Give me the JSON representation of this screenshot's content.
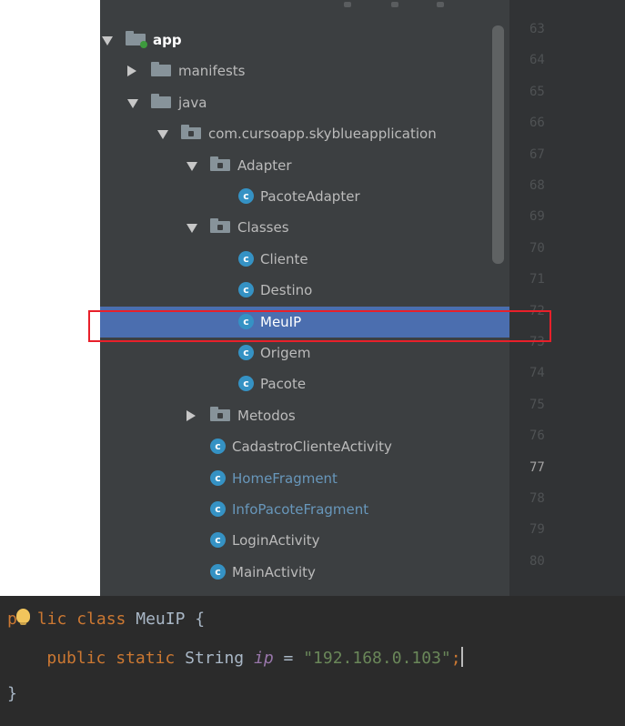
{
  "project_tree": {
    "items": [
      {
        "label": "app",
        "type": "module",
        "arrow": "down",
        "depth": 0
      },
      {
        "label": "manifests",
        "type": "folder",
        "arrow": "right",
        "depth": 1
      },
      {
        "label": "java",
        "type": "folder",
        "arrow": "down",
        "depth": 1
      },
      {
        "label": "com.cursoapp.skyblueapplication",
        "type": "package",
        "arrow": "down",
        "depth": 2
      },
      {
        "label": "Adapter",
        "type": "package",
        "arrow": "down",
        "depth": 3
      },
      {
        "label": "PacoteAdapter",
        "type": "class",
        "arrow": "",
        "depth": 4
      },
      {
        "label": "Classes",
        "type": "package",
        "arrow": "down",
        "depth": 3
      },
      {
        "label": "Cliente",
        "type": "class",
        "arrow": "",
        "depth": 4
      },
      {
        "label": "Destino",
        "type": "class",
        "arrow": "",
        "depth": 4
      },
      {
        "label": "MeuIP",
        "type": "class",
        "arrow": "",
        "depth": 4,
        "selected": true
      },
      {
        "label": "Origem",
        "type": "class",
        "arrow": "",
        "depth": 4
      },
      {
        "label": "Pacote",
        "type": "class",
        "arrow": "",
        "depth": 4
      },
      {
        "label": "Metodos",
        "type": "package",
        "arrow": "right",
        "depth": 3
      },
      {
        "label": "CadastroClienteActivity",
        "type": "class",
        "arrow": "",
        "depth": 3
      },
      {
        "label": "HomeFragment",
        "type": "class",
        "arrow": "",
        "depth": 3,
        "modified": true
      },
      {
        "label": "InfoPacoteFragment",
        "type": "class",
        "arrow": "",
        "depth": 3,
        "modified": true
      },
      {
        "label": "LoginActivity",
        "type": "class",
        "arrow": "",
        "depth": 3
      },
      {
        "label": "MainActivity",
        "type": "class",
        "arrow": "",
        "depth": 3
      }
    ]
  },
  "line_numbers": {
    "values": [
      "63",
      "64",
      "65",
      "66",
      "67",
      "68",
      "69",
      "70",
      "71",
      "72",
      "73",
      "74",
      "75",
      "76",
      "77",
      "78",
      "79",
      "80"
    ],
    "current": "77"
  },
  "code": {
    "line1": {
      "kw_public_prefix": "p",
      "kw_public_rest": "lic",
      "kw_class": "class",
      "name": "MeuIP",
      "brace": "{"
    },
    "line2": {
      "kw_public": "public",
      "kw_static": "static",
      "type": "String",
      "field": "ip",
      "eq": "=",
      "value": "\"192.168.0.103\"",
      "semi": ";"
    },
    "line3": {
      "brace": "}"
    }
  },
  "icons": {
    "class": "class-icon",
    "folder": "folder-icon",
    "package": "package-icon",
    "module": "module-icon",
    "intention": "bulb-icon"
  },
  "colors": {
    "selection": "#4b6eaf",
    "highlight": "#e8202a",
    "keyword": "#cc7832",
    "string": "#6a8759",
    "field": "#9876aa"
  }
}
